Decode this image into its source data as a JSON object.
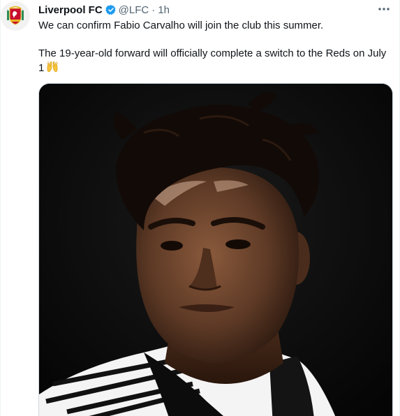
{
  "tweet": {
    "author_name": "Liverpool FC",
    "handle": "@LFC",
    "separator": "·",
    "time": "1h",
    "paragraph_1": "We can confirm Fabio Carvalho will join the club this summer.",
    "paragraph_2": "The 19-year-old forward will officially complete a switch to the Reds on July 1",
    "emoji": "raising-hands-emoji",
    "avatar_icon": "liverpool-crest-icon",
    "verified_icon": "verified-badge-icon",
    "more_icon": "more-options-icon",
    "media_description_icon": "player-photo"
  },
  "colors": {
    "text": "#0f1419",
    "secondary": "#536471",
    "verified_blue": "#1d9bf0",
    "crest_red": "#c8102e"
  }
}
